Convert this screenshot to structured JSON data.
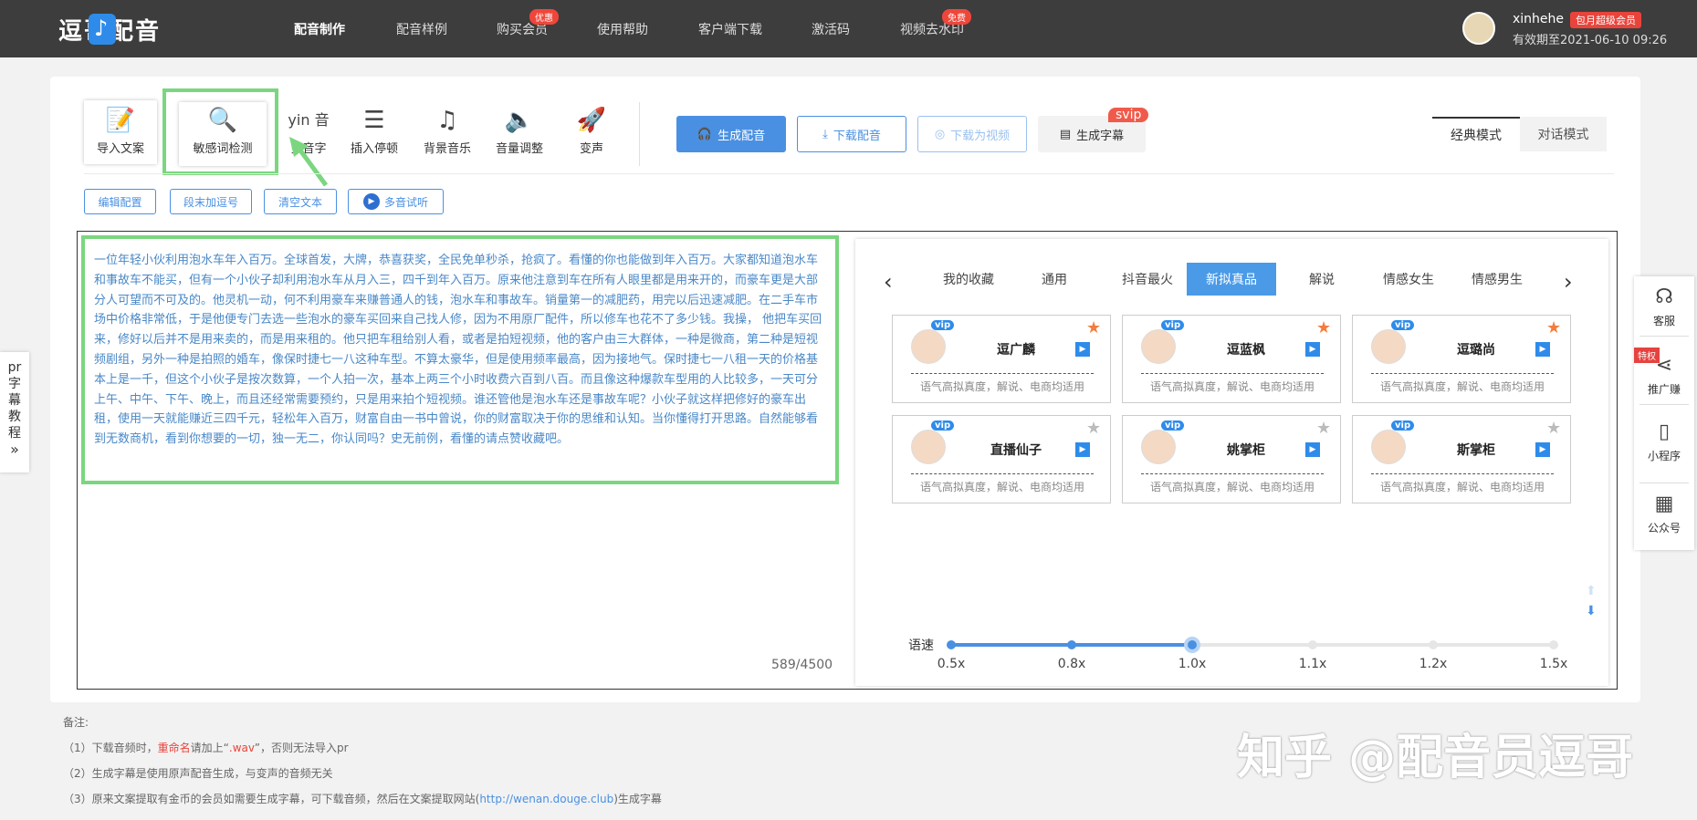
{
  "header": {
    "logo_text": "逗哥配音",
    "nav": [
      {
        "label": "配音制作",
        "active": true
      },
      {
        "label": "配音样例"
      },
      {
        "label": "购买会员",
        "badge": "优惠"
      },
      {
        "label": "使用帮助"
      },
      {
        "label": "客户端下载"
      },
      {
        "label": "激活码"
      },
      {
        "label": "视频去水印",
        "badge": "免费"
      }
    ],
    "user": {
      "name": "xinhehe",
      "vip_label": "包月超级会员",
      "expire": "有效期至2021-06-10 09:26"
    }
  },
  "toolbar": {
    "tools": [
      {
        "label": "导入文案",
        "icon": "import-doc-icon"
      },
      {
        "label": "敏感词检测",
        "icon": "sensitive-check-icon"
      },
      {
        "label": "多音字",
        "icon": "polyphone-icon",
        "icon_text": "yin 音"
      },
      {
        "label": "插入停顿",
        "icon": "pause-icon"
      },
      {
        "label": "背景音乐",
        "icon": "music-icon"
      },
      {
        "label": "音量调整",
        "icon": "volume-icon"
      },
      {
        "label": "变声",
        "icon": "voice-change-icon"
      }
    ],
    "actions": {
      "generate": "生成配音",
      "download": "下载配音",
      "download_video": "下载为视频",
      "subtitles": "生成字幕",
      "subtitles_badge": "svip"
    },
    "modes": [
      "经典模式",
      "对话模式"
    ]
  },
  "subtoolbar": {
    "edit_config": "编辑配置",
    "add_period": "段末加逗号",
    "clear_text": "清空文本",
    "multi_listen": "多音试听"
  },
  "editor": {
    "text": "一位年轻小伙利用泡水车年入百万。全球首发，大牌，恭喜获奖，全民免单秒杀，抢疯了。看懂的你也能做到年入百万。大家都知道泡水车和事故车不能买，但有一个小伙子却利用泡水车从月入三，四千到年入百万。原来他注意到车在所有人眼里都是用来开的，而豪车更是大部分人可望而不可及的。他灵机一动，何不利用豪车来赚普通人的钱，泡水车和事故车。销量第一的减肥药，用完以后迅速减肥。在二手车市场中价格非常低，于是他便专门去选一些泡水的豪车买回来自己找人修，因为不用原厂配件，所以修车也花不了多少钱。我操， 他把车买回来，修好以后并不是用来卖的，而是用来租的。他只把车租给别人看，或者是拍短视频，他的客户由三大群体，一种是微商，第二种是短视频剧组，另外一种是拍照的婚车，像保时捷七一八这种车型。不算太豪华，但是使用频率最高，因为接地气。保时捷七一八租一天的价格基本上是一千，但这个小伙子是按次数算，一个人拍一次，基本上两三个小时收费六百到八百。而且像这种爆款车型用的人比较多，一天可分上午、中午、下午、晚上，而且还经常需要预约，只是用来拍个短视频。谁还管他是泡水车还是事故车呢？小伙子就这样把修好的豪车出租，使用一天就能赚近三四千元，轻松年入百万，财富自由一书中曾说，你的财富取决于你的思维和认知。当你懂得打开思路。自然能够看到无数商机，看到你想要的一切，独一无二，你认同吗？史无前例，看懂的请点赞收藏吧。",
    "counter": "589/4500"
  },
  "voices": {
    "categories": [
      "我的收藏",
      "通用",
      "抖音最火",
      "新拟真品",
      "解说",
      "情感女生",
      "情感男生"
    ],
    "active_category": "新拟真品",
    "cards": [
      {
        "name": "逗广麟",
        "vip": "vip",
        "desc": "语气高拟真度，解说、电商均适用",
        "fav": true,
        "gender": "male"
      },
      {
        "name": "逗蓝枫",
        "vip": "vip",
        "desc": "语气高拟真度，解说、电商均适用",
        "fav": true,
        "gender": "male"
      },
      {
        "name": "逗璐尚",
        "vip": "vip",
        "desc": "语气高拟真度，解说、电商均适用",
        "fav": true,
        "gender": "female"
      },
      {
        "name": "直播仙子",
        "vip": "vip",
        "desc": "语气高拟真度，解说、电商均适用",
        "fav": false,
        "gender": "female"
      },
      {
        "name": "姚掌柜",
        "vip": "vip",
        "desc": "语气高拟真度，解说、电商均适用",
        "fav": false,
        "gender": "female"
      },
      {
        "name": "斯掌柜",
        "vip": "vip",
        "desc": "语气高拟真度，解说、电商均适用",
        "fav": false,
        "gender": "female"
      }
    ],
    "speed_label": "语速",
    "speed_options": [
      "0.5x",
      "0.8x",
      "1.0x",
      "1.1x",
      "1.2x",
      "1.5x"
    ],
    "speed_selected_index": 2
  },
  "left_tab": {
    "label": "pr字幕教程"
  },
  "right_bar": [
    {
      "label": "客服",
      "icon": "headset-icon"
    },
    {
      "label": "推广赚",
      "icon": "share-icon",
      "badge": "特权"
    },
    {
      "label": "小程序",
      "icon": "mobile-icon"
    },
    {
      "label": "公众号",
      "icon": "qrcode-icon"
    }
  ],
  "notes": {
    "title": "备注:",
    "line1_pre": "（1）下载音频时，",
    "line1_red": "重命名",
    "line1_mid": "请加上“",
    "line1_ext": ".wav",
    "line1_post": "”，否则无法导入pr",
    "line2": "（2）生成字幕是使用原声配音生成，与变声的音频无关",
    "line3_pre": "（3）原来文案提取有金币的会员如需要生成字幕，可下载音频，然后在文案提取网站(",
    "line3_link": "http://wenan.douge.club",
    "line3_post": ")生成字幕"
  },
  "watermark": "知乎 @配音员逗哥",
  "colors": {
    "accent": "#4a90e2",
    "highlight_green": "#7bd67f",
    "badge_red": "#f0463a",
    "text_blue": "#4a88c7"
  }
}
